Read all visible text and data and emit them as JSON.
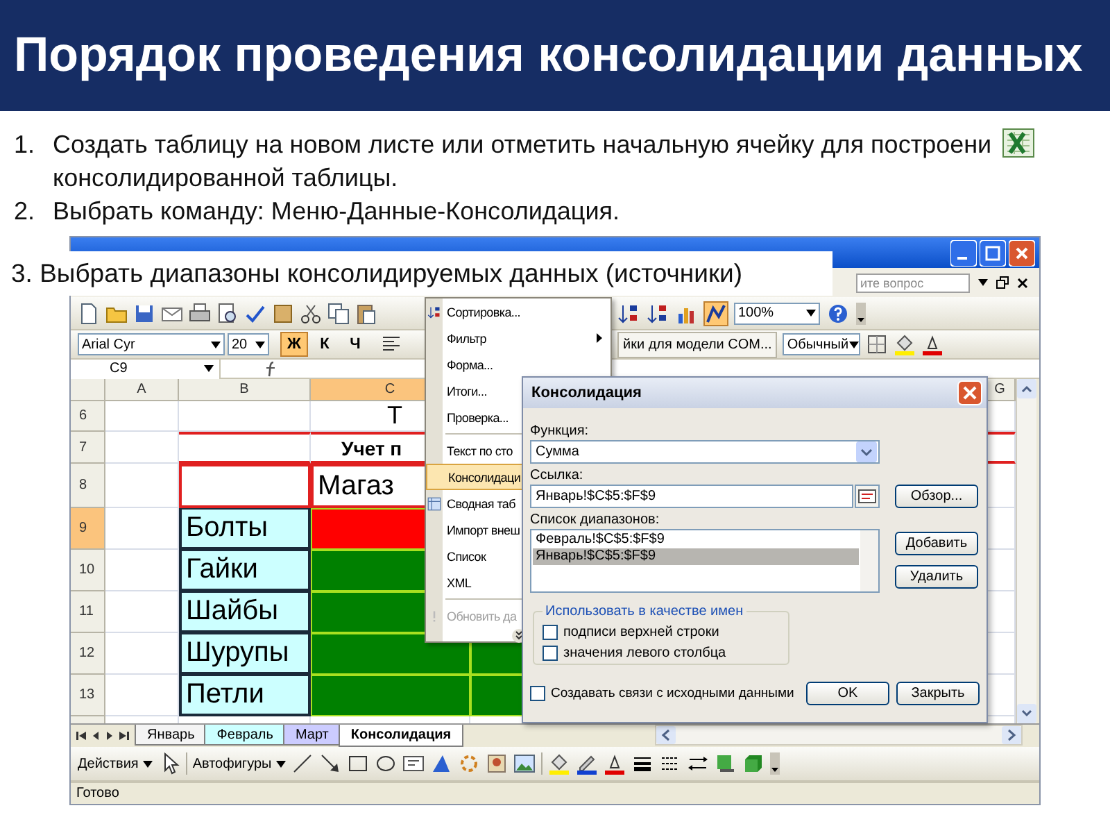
{
  "slide": {
    "title": "Порядок проведения консолидации данных"
  },
  "steps": [
    {
      "number": "1.",
      "lines": [
        "Создать таблицу на новом листе или отметить начальную ячейку для построени",
        "консолидированной таблицы."
      ]
    },
    {
      "number": "2.",
      "lines": [
        "Выбрать команду: Меню-Данные-Консолидация."
      ]
    }
  ],
  "callout": {
    "text": "3. Выбрать диапазоны консолидируемых данных (источники)"
  },
  "excel": {
    "help_field": {
      "placeholder": "ите вопрос"
    },
    "zoom": "100%",
    "font": "Arial Cyr",
    "font_size": "20",
    "format_buttons": [
      {
        "label": "Ж",
        "selected": true
      },
      {
        "label": "К",
        "selected": false
      },
      {
        "label": "Ч",
        "selected": false
      }
    ],
    "toolbar_button": "йки для модели COM...",
    "style": "Обычный",
    "name_box": "C9",
    "columns": [
      {
        "label": "A",
        "selected": false
      },
      {
        "label": "B",
        "selected": false
      },
      {
        "label": "C",
        "selected": true
      },
      {
        "label": "G",
        "selected": false
      }
    ],
    "rows": [
      {
        "label": "6",
        "selected": false,
        "kind": "title",
        "cells": [
          {},
          {},
          {
            "text": "Т"
          },
          {}
        ]
      },
      {
        "label": "7",
        "selected": false,
        "kind": "caption",
        "cells": [
          {},
          {},
          {
            "text": "Учет п"
          },
          {}
        ]
      },
      {
        "label": "8",
        "selected": false,
        "kind": "header",
        "cells": [
          {},
          {},
          {
            "text": "Магаз"
          },
          {}
        ]
      },
      {
        "label": "9",
        "selected": true,
        "kind": "item",
        "cells": [
          {},
          {
            "text": "Болты",
            "color": "#ccffff"
          },
          {
            "color": "#ff0000"
          },
          {}
        ]
      },
      {
        "label": "10",
        "selected": false,
        "kind": "item",
        "cells": [
          {},
          {
            "text": "Гайки",
            "color": "#ccffff"
          },
          {
            "color": "#008000"
          },
          {}
        ]
      },
      {
        "label": "11",
        "selected": false,
        "kind": "item",
        "cells": [
          {},
          {
            "text": "Шайбы",
            "color": "#ccffff"
          },
          {
            "color": "#008000"
          },
          {}
        ]
      },
      {
        "label": "12",
        "selected": false,
        "kind": "item",
        "cells": [
          {},
          {
            "text": "Шурупы",
            "color": "#ccffff"
          },
          {
            "color": "#008000"
          },
          {
            "color": "#008000"
          }
        ]
      },
      {
        "label": "13",
        "selected": false,
        "kind": "item",
        "cells": [
          {},
          {
            "text": "Петли",
            "color": "#ccffff"
          },
          {
            "color": "#008000"
          },
          {
            "color": "#008000"
          }
        ]
      }
    ],
    "sheet_tabs": [
      {
        "label": "Январь",
        "selected": false,
        "color": "#f4f4f4"
      },
      {
        "label": "Февраль",
        "selected": false,
        "color": "#ccffff"
      },
      {
        "label": "Март",
        "selected": false,
        "color": "#ccccff"
      },
      {
        "label": "Консолидация",
        "selected": true,
        "color": "#ffffff"
      }
    ],
    "draw_toolbar": {
      "actions": "Действия",
      "autoshapes": "Автофигуры"
    },
    "status": "Готово",
    "menu": {
      "items": [
        {
          "kind": "sort",
          "label": "Сортировка...",
          "selected": false,
          "disabled": false
        },
        {
          "kind": "submenu",
          "label": "Фильтр",
          "selected": false,
          "disabled": false
        },
        {
          "kind": "item",
          "label": "Форма...",
          "selected": false,
          "disabled": false
        },
        {
          "kind": "item",
          "label": "Итоги...",
          "selected": false,
          "disabled": false
        },
        {
          "kind": "item",
          "label": "Проверка...",
          "selected": false,
          "disabled": false
        },
        {
          "kind": "separator"
        },
        {
          "kind": "item",
          "label": "Текст по сто",
          "selected": false,
          "disabled": false
        },
        {
          "kind": "item",
          "label": "Консолидаци",
          "selected": true,
          "disabled": false
        },
        {
          "kind": "pivot",
          "label": "Сводная таб",
          "selected": false,
          "disabled": false
        },
        {
          "kind": "item",
          "label": "Импорт внеш",
          "selected": false,
          "disabled": false
        },
        {
          "kind": "item",
          "label": "Список",
          "selected": false,
          "disabled": false
        },
        {
          "kind": "item",
          "label": "XML",
          "selected": false,
          "disabled": false
        },
        {
          "kind": "separator"
        },
        {
          "kind": "refresh",
          "label": "Обновить да",
          "selected": false,
          "disabled": true
        },
        {
          "kind": "expand"
        }
      ]
    },
    "dialog": {
      "title": "Консолидация",
      "function_label": "Функция:",
      "function": "Сумма",
      "reference_label": "Ссылка:",
      "reference": "Январь!$C$5:$F$9",
      "browse": "Обзор...",
      "ranges_label": "Список диапазонов:",
      "ranges": [
        {
          "text": "Февраль!$C$5:$F$9",
          "selected": false
        },
        {
          "text": "Январь!$C$5:$F$9",
          "selected": true
        }
      ],
      "add": "Добавить",
      "delete": "Удалить",
      "names_group": "Использовать в качестве имен",
      "name_options": [
        {
          "label": "подписи верхней строки",
          "checked": false
        },
        {
          "label": "значения левого столбца",
          "checked": false
        }
      ],
      "link_option": {
        "label": "Создавать связи с исходными данными",
        "checked": false
      },
      "ok": "OK",
      "close": "Закрыть"
    }
  }
}
